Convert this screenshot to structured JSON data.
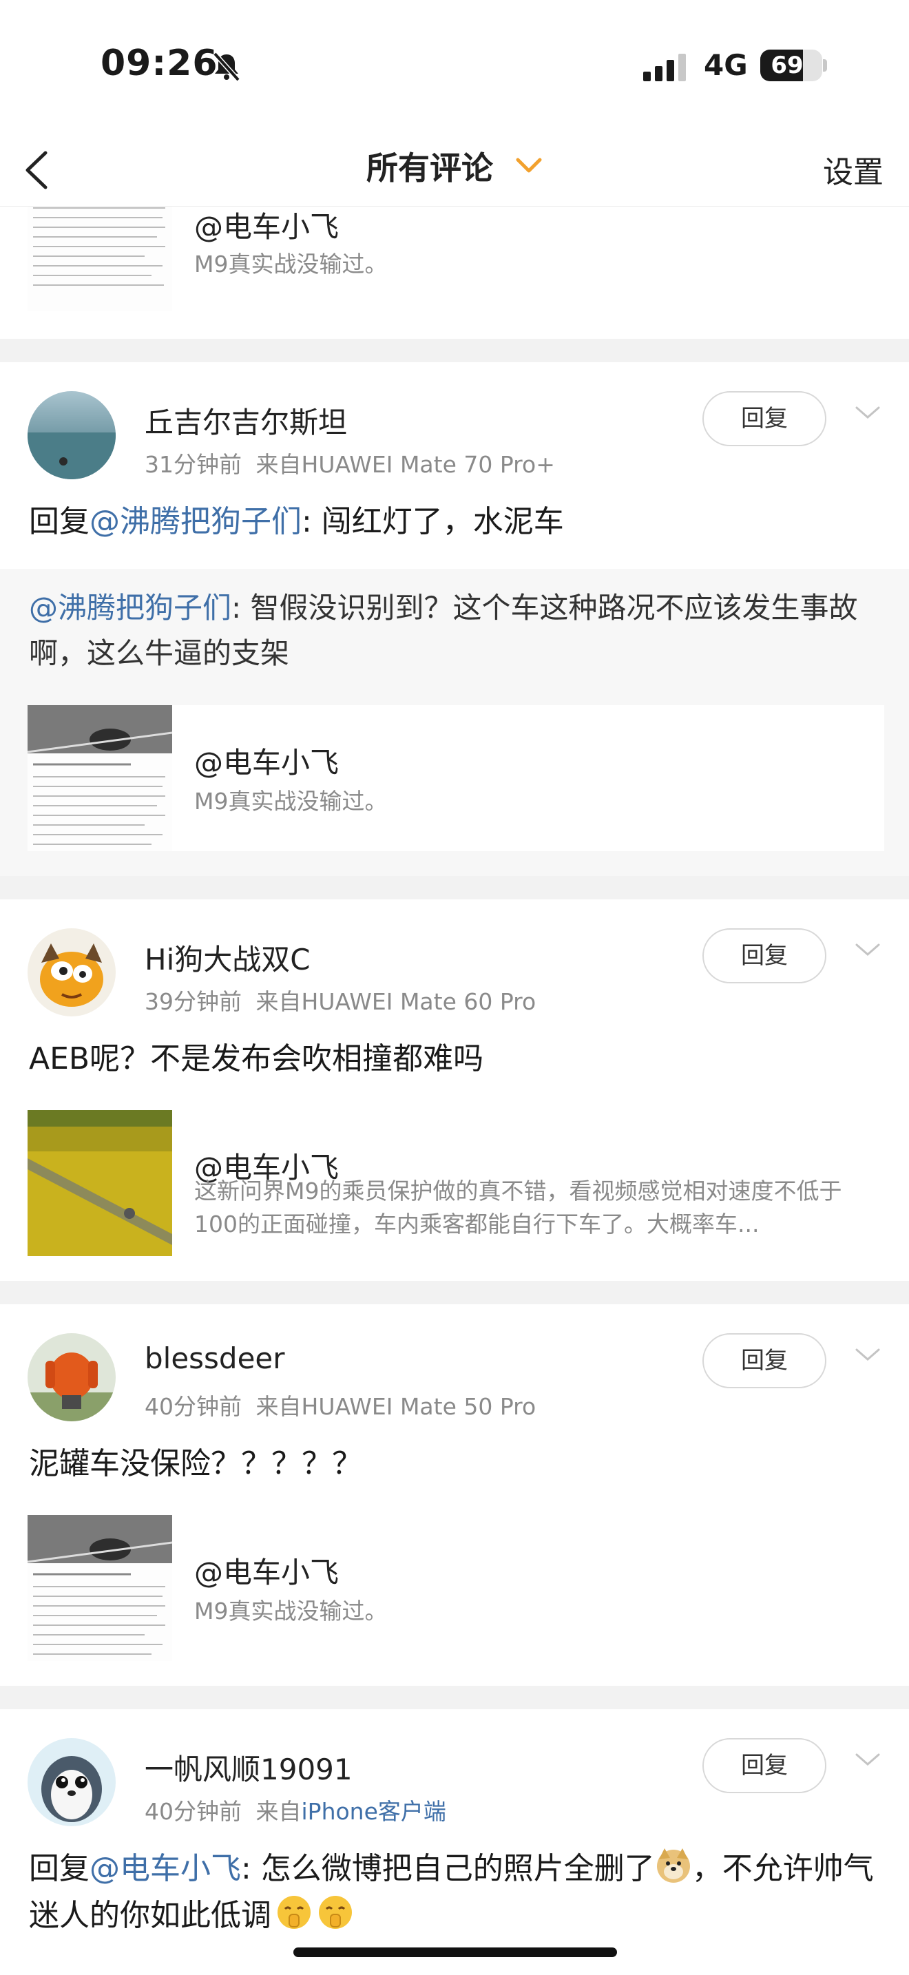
{
  "status_bar": {
    "time": "09:26",
    "network": "4G",
    "battery": "69",
    "battery_level": 0.69
  },
  "nav": {
    "title": "所有评论",
    "settings": "设置"
  },
  "top_card": {
    "author": "@电车小飞",
    "snippet": "M9真实战没输过。"
  },
  "comments": [
    {
      "user": "丘吉尔吉尔斯坦",
      "time": "31分钟前",
      "source_prefix": "来自",
      "source": "HUAWEI Mate 70 Pro+",
      "reply_label": "回复",
      "text_prefix": "回复",
      "text_mention": "@沸腾把狗子们",
      "text_body": ": 闯红灯了，水泥车",
      "quote_mention": "@沸腾把狗子们",
      "quote_body": ": 智假没识别到？这个车这种路况不应该发生事故啊，这么牛逼的支架",
      "card_author": "@电车小飞",
      "card_snippet": "M9真实战没输过。"
    },
    {
      "user": "Hi狗大战双C",
      "time": "39分钟前",
      "source_prefix": "来自",
      "source": "HUAWEI Mate 60 Pro",
      "reply_label": "回复",
      "text": "AEB呢？不是发布会吹相撞都难吗",
      "card_author": "@电车小飞",
      "card_snippet": "这新问界M9的乘员保护做的真不错，看视频感觉相对速度不低于100的正面碰撞，车内乘客都能自行下车了。大概率车..."
    },
    {
      "user": "blessdeer",
      "time": "40分钟前",
      "source_prefix": "来自",
      "source": "HUAWEI Mate 50 Pro",
      "reply_label": "回复",
      "text": "泥罐车没保险？？？？？",
      "card_author": "@电车小飞",
      "card_snippet": "M9真实战没输过。"
    },
    {
      "user": "一帆风顺19091",
      "time": "40分钟前",
      "source_prefix": "来自",
      "source": "iPhone客户端",
      "reply_label": "回复",
      "text_prefix": "回复",
      "text_mention": "@电车小飞",
      "text_body_1": ": 怎么微博把自己的照片全删了",
      "text_body_2": "，不允许帅气迷人的你如此低调"
    }
  ]
}
